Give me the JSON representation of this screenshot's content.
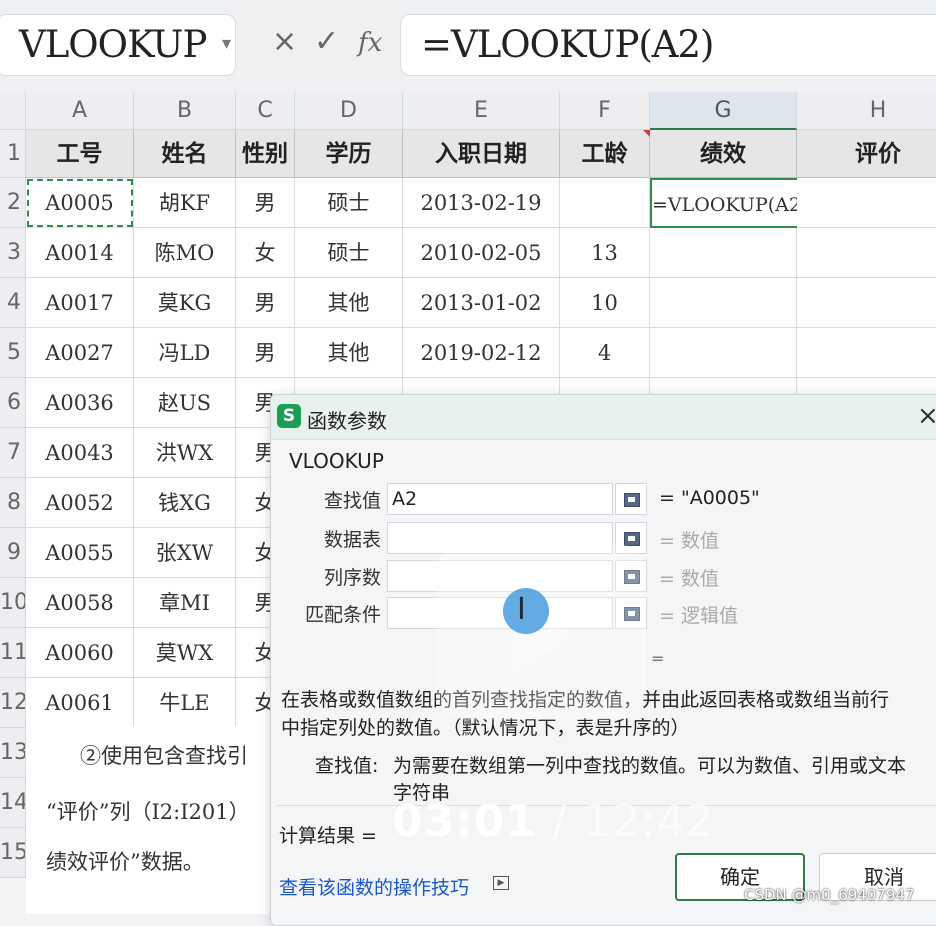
{
  "formula_bar": {
    "name_box": "VLOOKUP",
    "cancel_icon": "×",
    "confirm_icon": "✓",
    "fx_label": "fx",
    "formula": "=VLOOKUP(A2)"
  },
  "sheet": {
    "columns": [
      "A",
      "B",
      "C",
      "D",
      "E",
      "F",
      "G",
      "H"
    ],
    "rows": [
      "1",
      "2",
      "3",
      "4",
      "5",
      "6",
      "7",
      "8",
      "9",
      "10",
      "11",
      "12",
      "13",
      "14",
      "15"
    ],
    "headers": [
      "工号",
      "姓名",
      "性别",
      "学历",
      "入职日期",
      "工龄",
      "绩效",
      "评价"
    ],
    "data": [
      [
        "A0005",
        "胡KF",
        "男",
        "硕士",
        "2013-02-19",
        "",
        "=VLOOKUP(A2)"
      ],
      [
        "A0014",
        "陈MO",
        "女",
        "硕士",
        "2010-02-05",
        "13",
        ""
      ],
      [
        "A0017",
        "莫KG",
        "男",
        "其他",
        "2013-01-02",
        "10",
        ""
      ],
      [
        "A0027",
        "冯LD",
        "男",
        "其他",
        "2019-02-12",
        "4",
        ""
      ],
      [
        "A0036",
        "赵US",
        "男"
      ],
      [
        "A0043",
        "洪WX",
        "男"
      ],
      [
        "A0052",
        "钱XG",
        "女"
      ],
      [
        "A0055",
        "张XW",
        "女"
      ],
      [
        "A0058",
        "章MI",
        "男"
      ],
      [
        "A0060",
        "莫WX",
        "女"
      ],
      [
        "A0061",
        "牛LE",
        "女"
      ]
    ],
    "below_text": [
      "②使用包含查找引",
      "“评价”列（I2:I201）",
      "绩效评价”数据。"
    ]
  },
  "dialog": {
    "title": "函数参数",
    "close_icon": "×",
    "function_name": "VLOOKUP",
    "args": [
      {
        "label": "查找值",
        "value": "A2",
        "result": "= \"A0005\""
      },
      {
        "label": "数据表",
        "value": "",
        "result": "= 数值"
      },
      {
        "label": "列序数",
        "value": "",
        "result": "= 数值"
      },
      {
        "label": "匹配条件",
        "value": "",
        "result": "= 逻辑值"
      }
    ],
    "total_eq": "=",
    "description_line1": "在表格或数值数组的首列查找指定的数值，并由此返回表格或数组当前行",
    "description_line2": "中指定列处的数值。（默认情况下，表是升序的）",
    "param_label": "查找值:",
    "param_desc_line1": "为需要在数组第一列中查找的数值。可以为数值、引用或文本",
    "param_desc_line2": "字符串",
    "result_label": "计算结果 =",
    "help_link": "查看该函数的操作技巧",
    "ok_button": "确定",
    "cancel_button": "取消"
  },
  "overlay": {
    "current_time": "03:01",
    "total_time": " / 12:42",
    "watermark": "CSDN @m0_69407947"
  },
  "colors": {
    "accent": "#2f7a4a",
    "link": "#1a56c7",
    "logo": "#1e9e52"
  }
}
